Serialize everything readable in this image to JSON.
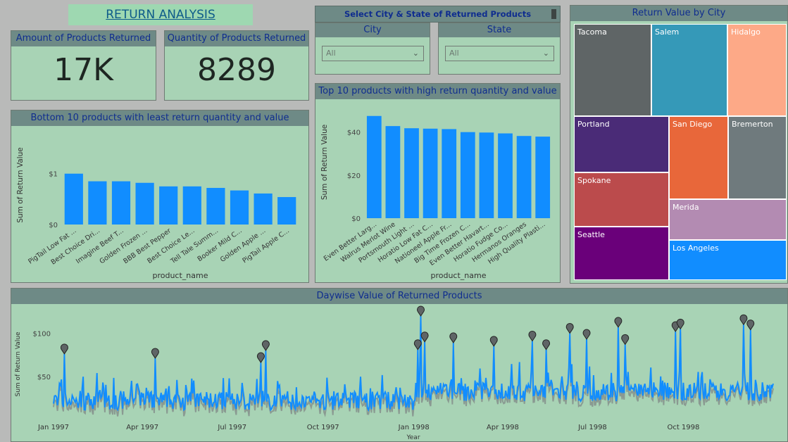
{
  "header": {
    "title": "RETURN ANALYSIS"
  },
  "kpis": {
    "amount": {
      "label": "Amount of Products Returned",
      "value": "17K"
    },
    "quantity": {
      "label": "Quantity of Products Returned",
      "value": "8289"
    }
  },
  "slicer": {
    "title": "Select City & State of Returned Products",
    "city": {
      "label": "City",
      "value": "All"
    },
    "state": {
      "label": "State",
      "value": "All"
    }
  },
  "treemap": {
    "title": "Return Value by City",
    "cells": [
      {
        "name": "Tacoma",
        "color": "#5f6566"
      },
      {
        "name": "Salem",
        "color": "#3599b8"
      },
      {
        "name": "Hidalgo",
        "color": "#fda987"
      },
      {
        "name": "Portland",
        "color": "#4a2b77"
      },
      {
        "name": "San Diego",
        "color": "#e8673a"
      },
      {
        "name": "Bremerton",
        "color": "#6f7a7d"
      },
      {
        "name": "Spokane",
        "color": "#bb4b4c"
      },
      {
        "name": "Merida",
        "color": "#b38bb2"
      },
      {
        "name": "Seattle",
        "color": "#6a007a"
      },
      {
        "name": "Los Angeles",
        "color": "#118dff"
      }
    ]
  },
  "chart_data": [
    {
      "id": "bottom10",
      "type": "bar",
      "title": "Bottom 10 products with least return quantity and value",
      "xlabel": "product_name",
      "ylabel": "Sum of Return Value",
      "ylim": [
        0,
        1.55
      ],
      "yticks": [
        {
          "v": 0,
          "label": "$0"
        },
        {
          "v": 1,
          "label": "$1"
        }
      ],
      "categories": [
        "PigTail Low Fat ...",
        "Best Choice Dri...",
        "Imagine Beef T...",
        "Golden Frozen ...",
        "BBB Best Pepper",
        "Best Choice Le...",
        "Tell Tale Summ...",
        "Booker Mild C...",
        "Golden Apple ...",
        "PigTail Apple C..."
      ],
      "values": [
        1.0,
        0.85,
        0.85,
        0.82,
        0.75,
        0.75,
        0.72,
        0.67,
        0.61,
        0.54
      ],
      "color": "#118dff"
    },
    {
      "id": "top10",
      "type": "bar",
      "title": "Top 10 products with high return quantity and value",
      "xlabel": "product_name",
      "ylabel": "Sum of Return Value",
      "ylim": [
        0,
        52
      ],
      "yticks": [
        {
          "v": 0,
          "label": "$0"
        },
        {
          "v": 20,
          "label": "$20"
        },
        {
          "v": 40,
          "label": "$40"
        }
      ],
      "categories": [
        "Even Better Larg...",
        "Walrus Merlot Wine",
        "Portsmouth Light ...",
        "Horatio Low Fat C...",
        "Nationeel Apple Fr...",
        "Big Time Frozen C...",
        "Even Better Havart...",
        "Horatio Fudge Co...",
        "Hermanos Oranges",
        "High Quality Plasti..."
      ],
      "values": [
        47.5,
        42.8,
        41.8,
        41.6,
        41.4,
        40.0,
        39.8,
        39.4,
        38.2,
        37.9
      ],
      "color": "#118dff"
    },
    {
      "id": "daywise",
      "type": "line",
      "title": "Daywise Value of Returned Products",
      "xlabel": "Year",
      "ylabel": "Sum of Return Value",
      "ylim": [
        0,
        130
      ],
      "yticks": [
        {
          "v": 50,
          "label": "$50"
        },
        {
          "v": 100,
          "label": "$100"
        }
      ],
      "xticks": [
        "Jan 1997",
        "Apr 1997",
        "Jul 1997",
        "Oct 1997",
        "Jan 1998",
        "Apr 1998",
        "Jul 1998",
        "Oct 1998"
      ],
      "x_range": [
        "1997-01-01",
        "1998-12-31"
      ],
      "anomalies": [
        {
          "date": "1997-01-12",
          "value": 77
        },
        {
          "date": "1997-04-14",
          "value": 72
        },
        {
          "date": "1997-07-30",
          "value": 67
        },
        {
          "date": "1997-08-04",
          "value": 81
        },
        {
          "date": "1998-01-05",
          "value": 82
        },
        {
          "date": "1998-01-08",
          "value": 121
        },
        {
          "date": "1998-01-12",
          "value": 91
        },
        {
          "date": "1998-02-10",
          "value": 90
        },
        {
          "date": "1998-03-23",
          "value": 86
        },
        {
          "date": "1998-05-01",
          "value": 92
        },
        {
          "date": "1998-05-15",
          "value": 82
        },
        {
          "date": "1998-06-08",
          "value": 101
        },
        {
          "date": "1998-06-25",
          "value": 94
        },
        {
          "date": "1998-07-27",
          "value": 108
        },
        {
          "date": "1998-08-03",
          "value": 88
        },
        {
          "date": "1998-09-23",
          "value": 103
        },
        {
          "date": "1998-09-28",
          "value": 106
        },
        {
          "date": "1998-12-01",
          "value": 111
        },
        {
          "date": "1998-12-08",
          "value": 105
        }
      ],
      "line_color": "#118dff",
      "marker_color": "#5f6566"
    }
  ]
}
